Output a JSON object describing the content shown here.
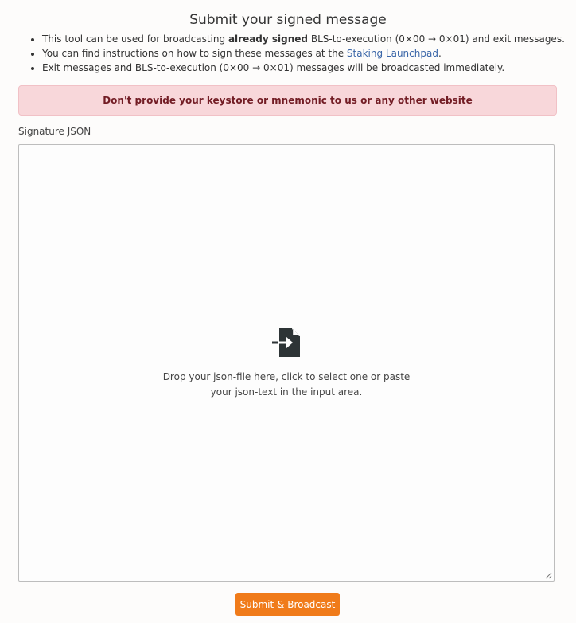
{
  "header": {
    "title": "Submit your signed message"
  },
  "info": {
    "line1_pre": "This tool can be used for broadcasting ",
    "line1_bold": "already signed",
    "line1_post": " BLS-to-execution (0×00 → 0×01) and exit messages.",
    "line2_pre": "You can find instructions on how to sign these messages at the ",
    "line2_link": "Staking Launchpad",
    "line2_post": ".",
    "line3": "Exit messages and BLS-to-execution (0×00 → 0×01) messages will be broadcasted immediately."
  },
  "warning": {
    "text": "Don't provide your keystore or mnemonic to us or any other website"
  },
  "form": {
    "label": "Signature JSON",
    "dropzone_text": "Drop your json-file here, click to select one or paste your json-text in the input area.",
    "icon": "file-import-icon",
    "submit_label": "Submit & Broadcast"
  },
  "colors": {
    "accent": "#f07b1a",
    "warning_bg": "#f8d7da",
    "warning_text": "#721c24",
    "link": "#3a66a8"
  }
}
